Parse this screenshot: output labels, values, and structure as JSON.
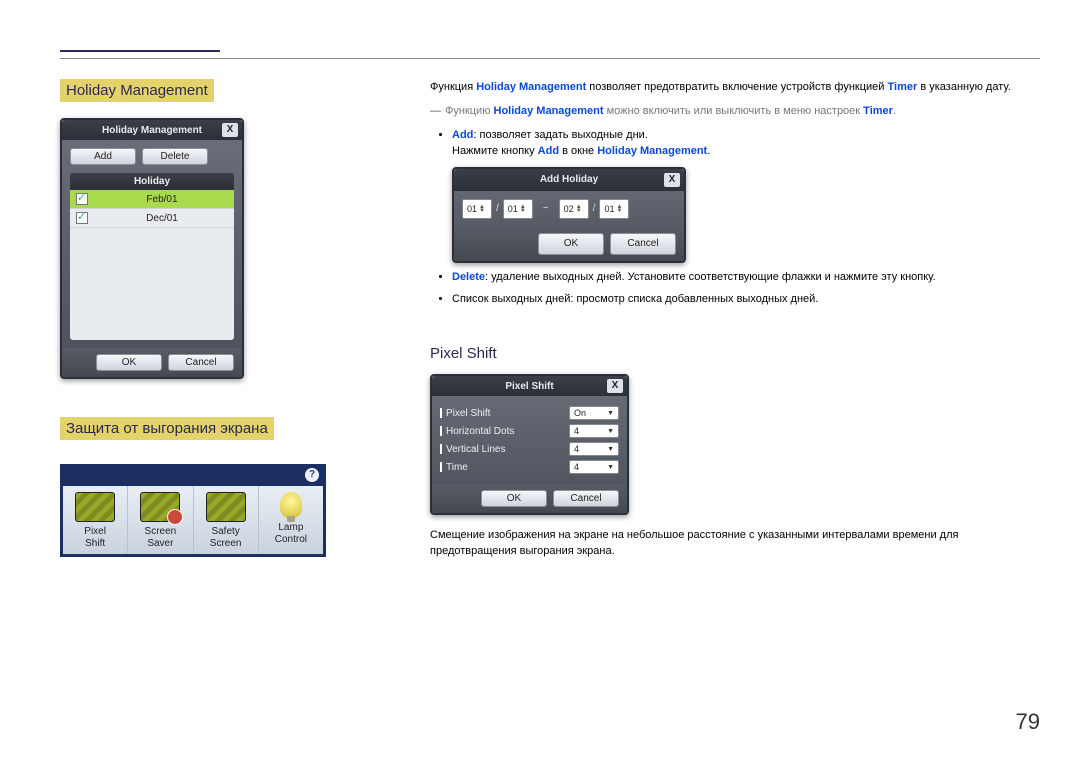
{
  "page_number": "79",
  "section1": {
    "heading": "Holiday Management",
    "dlg": {
      "title": "Holiday Management",
      "close": "X",
      "add": "Add",
      "delete": "Delete",
      "col_header": "Holiday",
      "rows": [
        {
          "checked": true,
          "date": "Feb/01",
          "selected": true
        },
        {
          "checked": true,
          "date": "Dec/01",
          "selected": false
        }
      ],
      "ok": "OK",
      "cancel": "Cancel"
    }
  },
  "right1": {
    "intro_pre": "Функция ",
    "intro_hm": "Holiday Management",
    "intro_mid": " позволяет предотвратить включение устройств функцией ",
    "intro_timer": "Timer",
    "intro_post": " в указанную дату.",
    "note_pre": "Функцию ",
    "note_hm": "Holiday Management",
    "note_mid": " можно включить или выключить в меню настроек ",
    "note_timer": "Timer",
    "note_end": ".",
    "add_label": "Add",
    "add_text": ": позволяет задать выходные дни.",
    "add_line2_pre": "Нажмите кнопку ",
    "add_line2_add": "Add",
    "add_line2_mid": " в окне ",
    "add_line2_hm": "Holiday Management",
    "add_line2_end": ".",
    "delete_label": "Delete",
    "delete_text": ": удаление выходных дней. Установите соответствующие флажки и нажмите эту кнопку.",
    "list_text": "Список выходных дней: просмотр списка добавленных выходных дней.",
    "add_dlg": {
      "title": "Add Holiday",
      "close": "X",
      "m1": "01",
      "d1": "01",
      "sep_date": "/",
      "sep_range": "~",
      "m2": "02",
      "d2": "01",
      "ok": "OK",
      "cancel": "Cancel"
    }
  },
  "section2": {
    "heading": "Защита от выгорания экрана",
    "help": "?",
    "icons": [
      {
        "l1": "Pixel",
        "l2": "Shift"
      },
      {
        "l1": "Screen",
        "l2": "Saver"
      },
      {
        "l1": "Safety",
        "l2": "Screen"
      },
      {
        "l1": "Lamp",
        "l2": "Control"
      }
    ]
  },
  "right2": {
    "heading": "Pixel Shift",
    "dlg": {
      "title": "Pixel Shift",
      "close": "X",
      "rows": [
        {
          "label": "Pixel Shift",
          "value": "On"
        },
        {
          "label": "Horizontal Dots",
          "value": "4"
        },
        {
          "label": "Vertical Lines",
          "value": "4"
        },
        {
          "label": "Time",
          "value": "4"
        }
      ],
      "ok": "OK",
      "cancel": "Cancel"
    },
    "desc": "Смещение изображения на экране на небольшое расстояние с указанными интервалами времени для предотвращения выгорания экрана."
  }
}
